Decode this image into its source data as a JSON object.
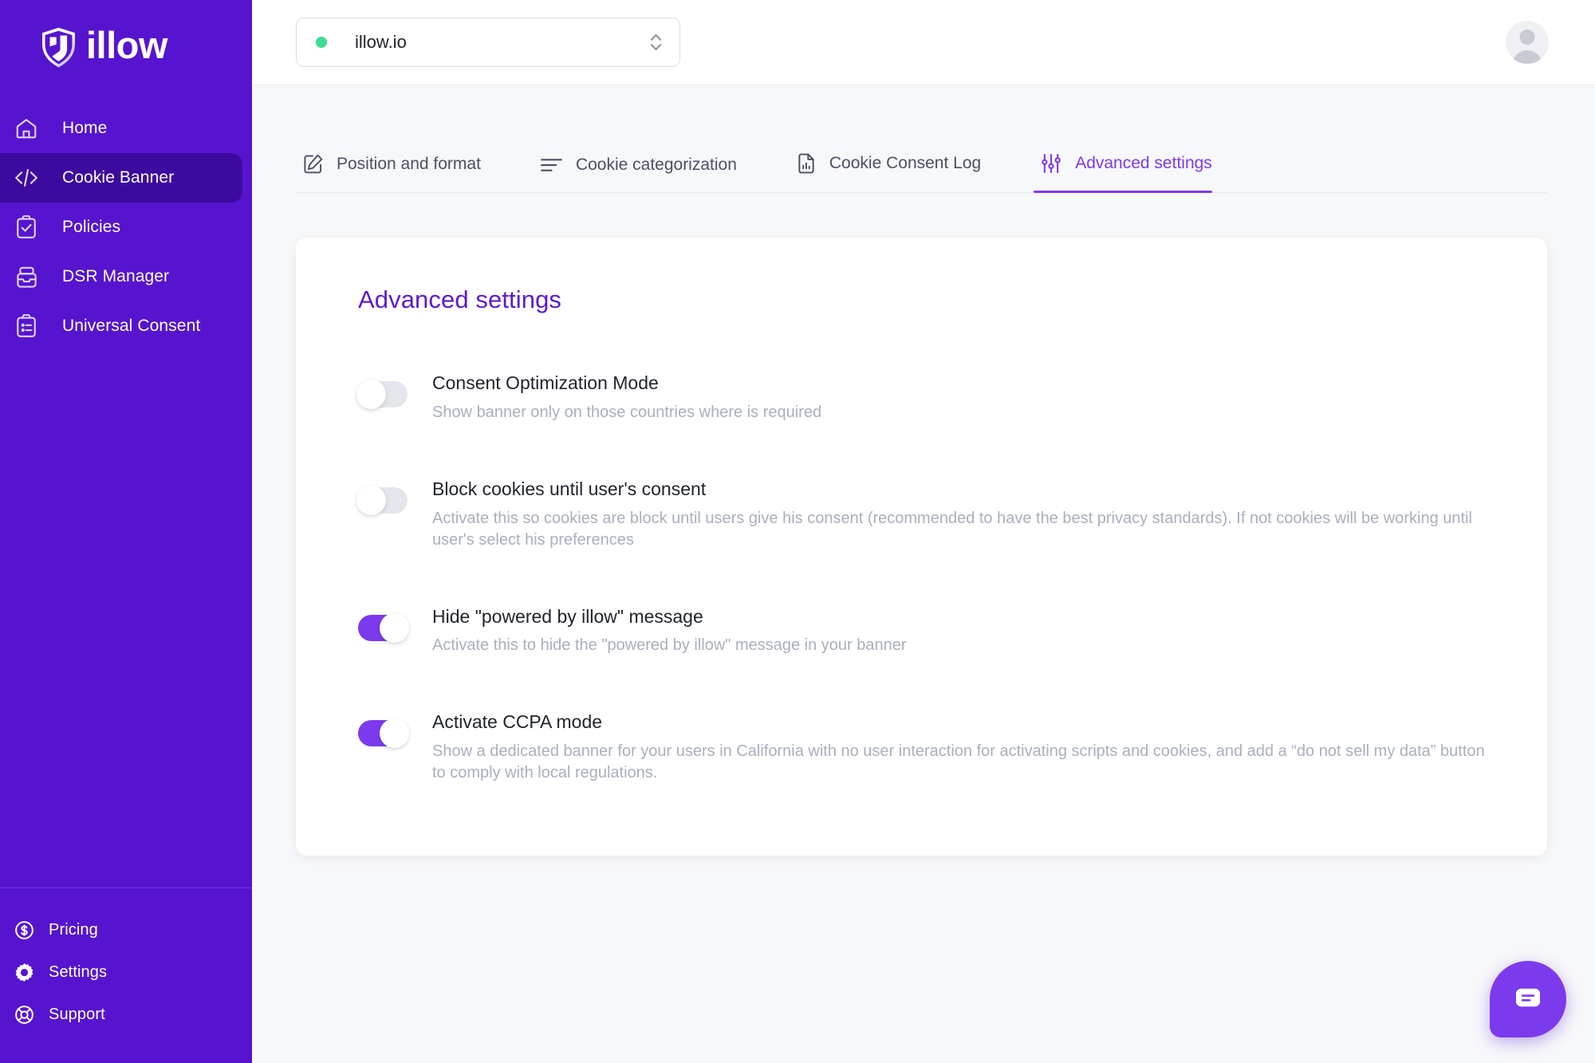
{
  "brand": {
    "name": "illow",
    "logo_icon": "shield-logo-icon",
    "sidebar_color": "#5614cf",
    "active_item_color": "#3d0aa0",
    "accent_color": "#7c3aed",
    "title_color": "#5b1ad0"
  },
  "sidebar": {
    "items": [
      {
        "label": "Home",
        "icon": "home-icon",
        "active": false
      },
      {
        "label": "Cookie Banner",
        "icon": "code-icon",
        "active": true
      },
      {
        "label": "Policies",
        "icon": "clipboard-check-icon",
        "active": false
      },
      {
        "label": "DSR Manager",
        "icon": "inbox-icon",
        "active": false
      },
      {
        "label": "Universal Consent",
        "icon": "clipboard-list-icon",
        "active": false
      }
    ],
    "footer_items": [
      {
        "label": "Pricing",
        "icon": "dollar-circle-icon"
      },
      {
        "label": "Settings",
        "icon": "gear-icon"
      },
      {
        "label": "Support",
        "icon": "lifebuoy-icon"
      }
    ]
  },
  "topbar": {
    "site_selector": {
      "value": "illow.io",
      "status": "online",
      "status_color": "#3ddc97",
      "icon": "chevron-updown-icon"
    },
    "avatar": {
      "icon": "user-avatar-icon"
    }
  },
  "tabs": [
    {
      "label": "Position and format",
      "icon": "edit-square-icon",
      "active": false
    },
    {
      "label": "Cookie categorization",
      "icon": "list-lines-icon",
      "active": false
    },
    {
      "label": "Cookie Consent Log",
      "icon": "document-chart-icon",
      "active": false
    },
    {
      "label": "Advanced settings",
      "icon": "sliders-icon",
      "active": true
    }
  ],
  "card": {
    "title": "Advanced settings",
    "settings": [
      {
        "label": "Consent Optimization Mode",
        "description": "Show banner only on those countries where is required",
        "enabled": false
      },
      {
        "label": "Block cookies until user's consent",
        "description": "Activate this so cookies are block until users give his consent (recommended to have the best privacy standards).  If not cookies will be working until user's select his preferences",
        "enabled": false
      },
      {
        "label": "Hide \"powered by illow\" message",
        "description": "Activate this to hide the \"powered by illow\" message in your banner",
        "enabled": true
      },
      {
        "label": "Activate CCPA mode",
        "description": "Show a dedicated banner for your users in California with no user interaction for activating scripts and cookies, and add a “do not sell my data” button to comply with local regulations.",
        "enabled": true
      }
    ]
  },
  "chat_widget": {
    "icon": "chat-bubble-icon"
  }
}
